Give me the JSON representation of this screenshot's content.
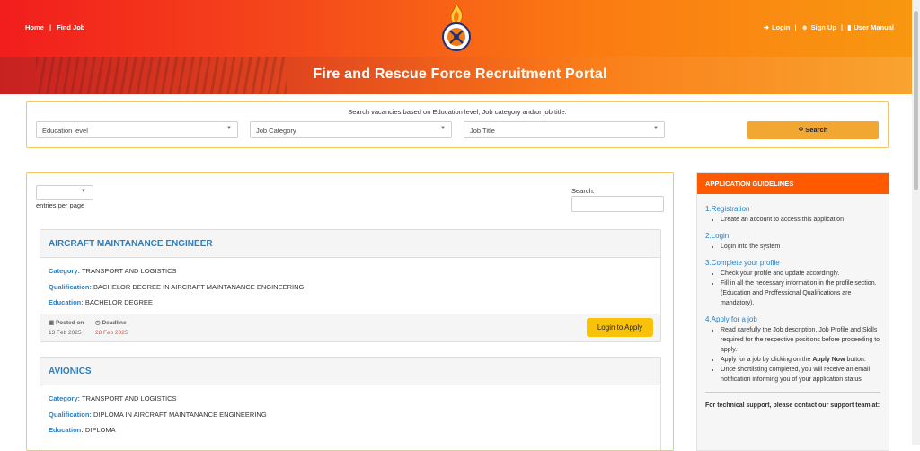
{
  "header": {
    "nav_left": [
      "Home",
      "|",
      "Find Job"
    ],
    "login": "Login",
    "signup": "Sign Up",
    "manual": "User Manual",
    "sep": "|",
    "portal_title": "Fire and Rescue Force Recruitment Portal"
  },
  "search": {
    "caption": "Search vacancies based on Education level, Job category and/or job title.",
    "education_placeholder": "Education level",
    "category_placeholder": "Job Category",
    "title_placeholder": "Job Title",
    "button_label": "Search"
  },
  "table": {
    "entries_label": "entries per page",
    "search_label": "Search:"
  },
  "labels": {
    "category": "Category:",
    "qualification": "Qualification:",
    "education": "Education:",
    "posted_on": "Posted on",
    "deadline": "Deadline",
    "apply": "Login to Apply"
  },
  "jobs": [
    {
      "title": "AIRCRAFT MAINTANANCE ENGINEER",
      "category": "TRANSPORT AND LOGISTICS",
      "qualification": "BACHELOR DEGREE IN AIRCRAFT MAINTANANCE ENGINEERING",
      "education": "BACHELOR DEGREE",
      "posted": "13 Feb 2025",
      "deadline": "28 Feb 2025"
    },
    {
      "title": "AVIONICS",
      "category": "TRANSPORT AND LOGISTICS",
      "qualification": "DIPLOMA IN AIRCRAFT MAINTANANCE ENGINEERING",
      "education": "DIPLOMA"
    }
  ],
  "guidelines": {
    "heading": "APPLICATION GUIDELINES",
    "sections": [
      {
        "title": "1.Registration",
        "items": [
          "Create an account to access this application"
        ]
      },
      {
        "title": "2.Login",
        "items": [
          "Login into the system"
        ]
      },
      {
        "title": "3.Complete your profile",
        "items": [
          "Check your profile and update accordingly.",
          "Fill in all the necessary information in the profile section. (Education and Proffessional Qualifications are mandatory)."
        ]
      },
      {
        "title": "4.Apply for a job",
        "items": [
          "Read carefully the Job description, Job Profile and Skills required for the respective positions before proceeding to apply.",
          "Apply for a job by clicking on the",
          "button.",
          "Once shortlisting completed, you will receive an email notification informing you of your application status."
        ],
        "apply_now": "Apply Now"
      }
    ],
    "contact": "For technical support, please contact our support team at:"
  },
  "colors": {
    "accent_blue": "#2a7fc1",
    "brand_orange": "#ff5a00",
    "apply_yellow": "#f9c20a",
    "deadline_red": "#d9534f"
  }
}
